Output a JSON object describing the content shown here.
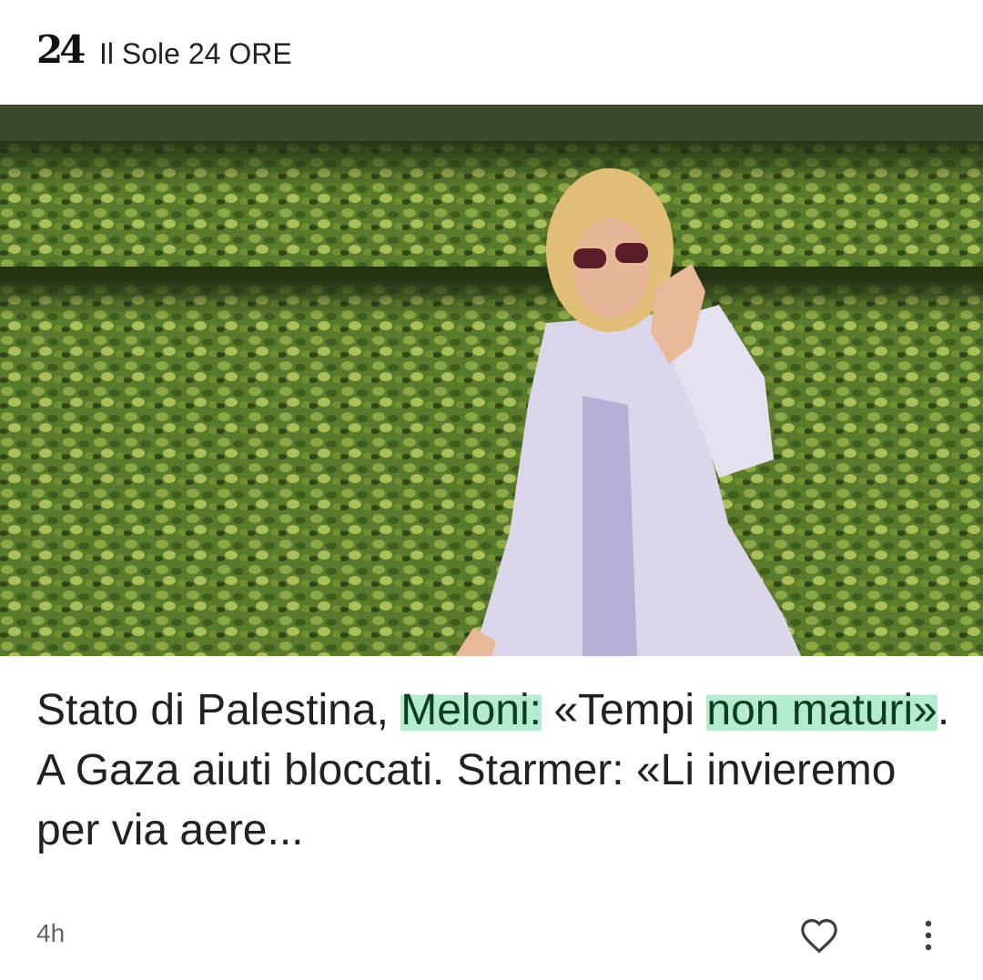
{
  "source": {
    "logo_text": "24",
    "name": "Il Sole 24 ORE"
  },
  "hero_image": {
    "alt": "Woman in lavender suit waving in front of green hedge"
  },
  "headline": {
    "part1": "Stato di Palestina, ",
    "highlight1": "Meloni:",
    "part2": " «Tempi ",
    "highlight2": "non maturi»",
    "part3": ". A Gaza aiuti bloccati. Starmer: «Li invieremo per via aere..."
  },
  "footer": {
    "time": "4h",
    "like_icon": "heart-outline-icon",
    "more_icon": "more-vertical-icon"
  },
  "colors": {
    "highlight": "#b5ecd0",
    "text": "#202124",
    "muted": "#5f6368"
  }
}
